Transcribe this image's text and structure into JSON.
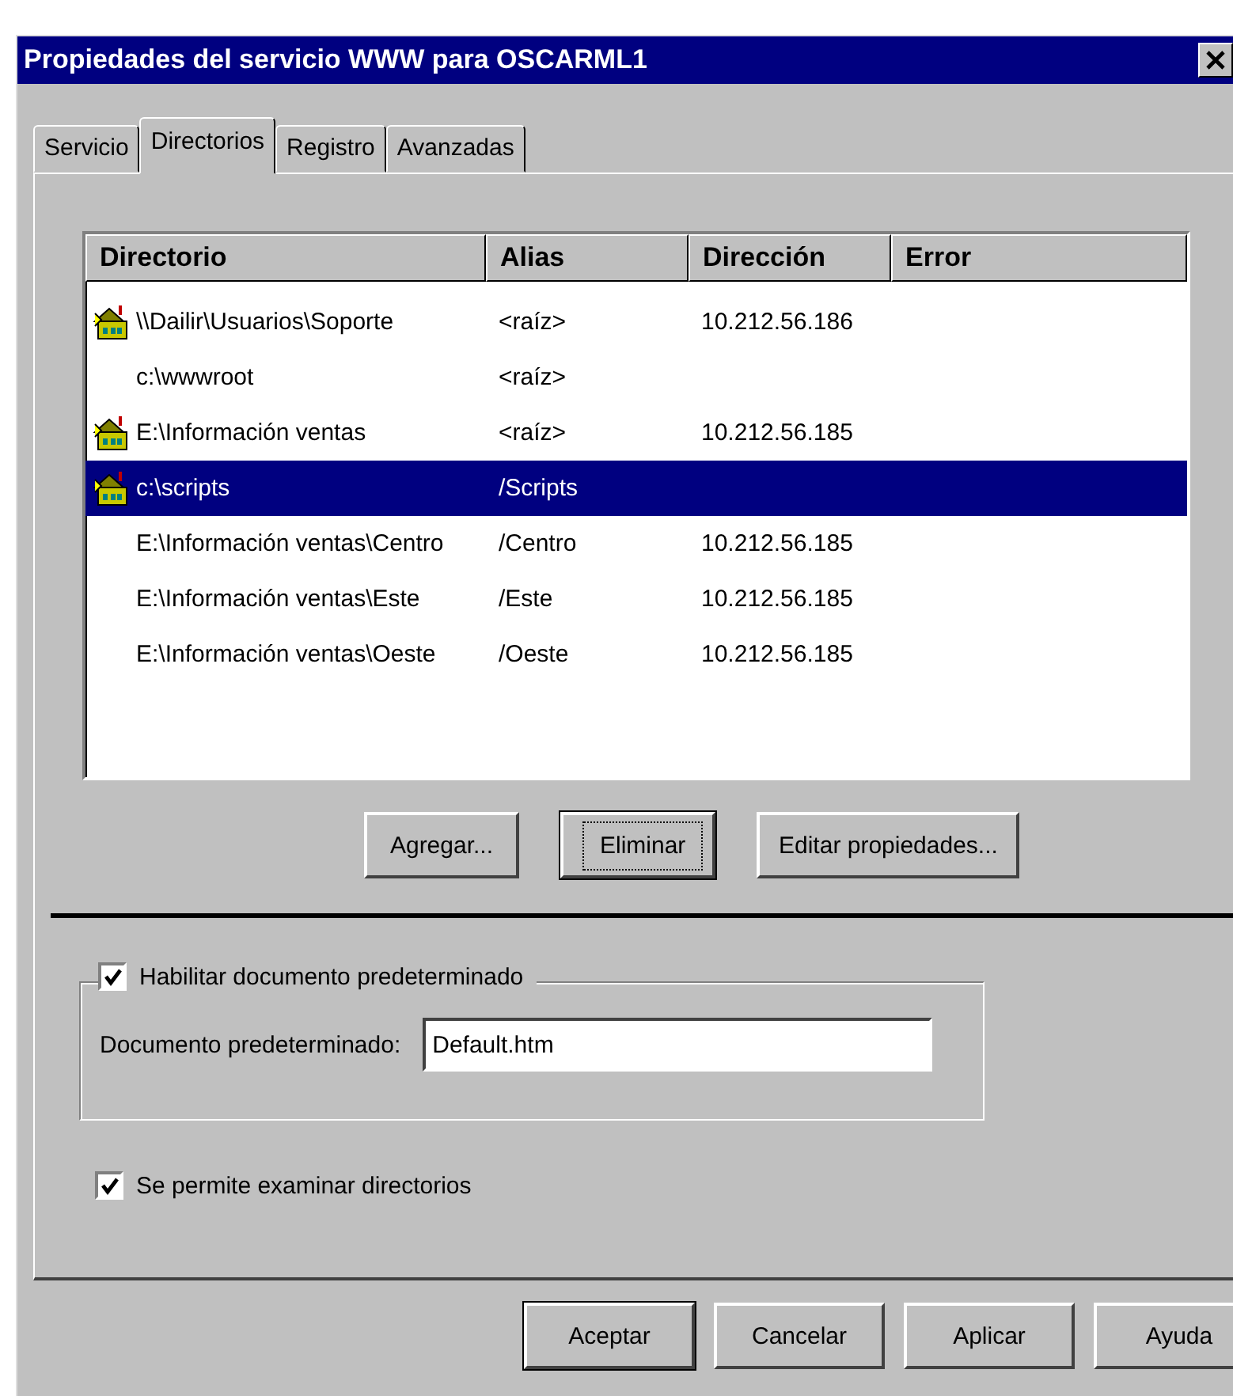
{
  "window": {
    "title": "Propiedades del servicio WWW para OSCARML1"
  },
  "tabs": [
    {
      "label": "Servicio",
      "selected": false
    },
    {
      "label": "Directorios",
      "selected": true
    },
    {
      "label": "Registro",
      "selected": false
    },
    {
      "label": "Avanzadas",
      "selected": false
    }
  ],
  "table": {
    "columns": [
      "Directorio",
      "Alias",
      "Dirección",
      "Error"
    ],
    "rows": [
      {
        "has_icon": true,
        "selected": false,
        "cells": [
          "\\\\Dailir\\Usuarios\\Soporte",
          "<raíz>",
          "10.212.56.186"
        ]
      },
      {
        "has_icon": false,
        "selected": false,
        "cells": [
          "c:\\wwwroot",
          "<raíz>"
        ]
      },
      {
        "has_icon": true,
        "selected": false,
        "cells": [
          "E:\\Información ventas",
          "<raíz>",
          "10.212.56.185"
        ]
      },
      {
        "has_icon": true,
        "selected": true,
        "cells": [
          "c:\\scripts",
          "/Scripts"
        ]
      },
      {
        "has_icon": false,
        "selected": false,
        "cells": [
          "E:\\Información ventas\\Centro",
          "/Centro",
          "10.212.56.185"
        ]
      },
      {
        "has_icon": false,
        "selected": false,
        "cells": [
          "E:\\Información ventas\\Este",
          "/Este",
          "10.212.56.185"
        ]
      },
      {
        "has_icon": false,
        "selected": false,
        "cells": [
          "E:\\Información ventas\\Oeste",
          "/Oeste",
          "10.212.56.185"
        ]
      }
    ]
  },
  "list_buttons": [
    {
      "label": "Agregar...",
      "default": false,
      "focused": false
    },
    {
      "label": "Eliminar",
      "default": true,
      "focused": true
    },
    {
      "label": "Editar propiedades...",
      "default": false,
      "focused": false
    }
  ],
  "default_document": {
    "enable_label": "Habilitar documento predeterminado",
    "checked": true,
    "field_label": "Documento predeterminado:",
    "value": "Default.htm"
  },
  "browse": {
    "label": "Se permite examinar directorios",
    "checked": true
  },
  "buttons": [
    {
      "label": "Aceptar",
      "default": true
    },
    {
      "label": "Cancelar",
      "default": false
    },
    {
      "label": "Aplicar",
      "default": false
    },
    {
      "label": "Ayuda",
      "default": false
    }
  ]
}
